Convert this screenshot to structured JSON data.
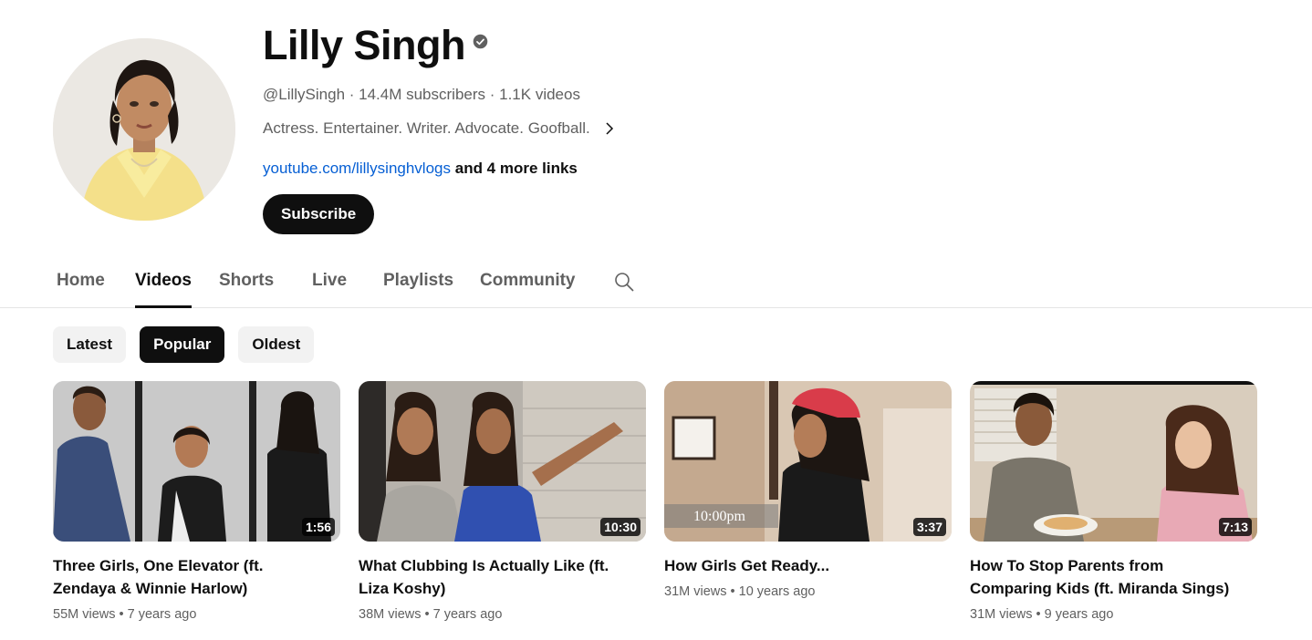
{
  "channel": {
    "name": "Lilly Singh",
    "meta": "@LillySingh · 14.4M subscribers · 1.1K videos",
    "description": "Actress. Entertainer. Writer. Advocate. Goofball.",
    "link": "youtube.com/lillysinghvlogs",
    "more_links": "and 4 more links",
    "subscribe_label": "Subscribe",
    "icons": {
      "verified": "verified-check-icon",
      "expand": "chevron-right-icon"
    }
  },
  "tabs": [
    {
      "label": "Home",
      "active": false
    },
    {
      "label": "Videos",
      "active": true
    },
    {
      "label": "Shorts",
      "active": false
    },
    {
      "label": "Live",
      "active": false
    },
    {
      "label": "Playlists",
      "active": false
    },
    {
      "label": "Community",
      "active": false
    }
  ],
  "tab_search_icon": "search-icon",
  "filters": [
    {
      "label": "Latest",
      "active": false
    },
    {
      "label": "Popular",
      "active": true
    },
    {
      "label": "Oldest",
      "active": false
    }
  ],
  "videos": [
    {
      "title_line1": "Three Girls, One Elevator (ft.",
      "title_line2": "Zendaya & Winnie Harlow)",
      "duration": "1:56",
      "meta": "55M views • 7 years ago"
    },
    {
      "title_line1": "What Clubbing Is Actually Like (ft.",
      "title_line2": "Liza Koshy)",
      "duration": "10:30",
      "meta": "38M views • 7 years ago"
    },
    {
      "title_line1": "How Girls Get Ready...",
      "title_line2": "",
      "duration": "3:37",
      "meta": "31M views • 10 years ago",
      "thumb_caption": "10:00pm"
    },
    {
      "title_line1": "How To Stop Parents from",
      "title_line2": "Comparing Kids (ft. Miranda Sings)",
      "duration": "7:13",
      "meta": "31M views • 9 years ago"
    }
  ],
  "colors": {
    "link": "#065fd4",
    "text": "#0f0f0f",
    "secondary": "#606060",
    "chip": "#f2f2f2"
  }
}
